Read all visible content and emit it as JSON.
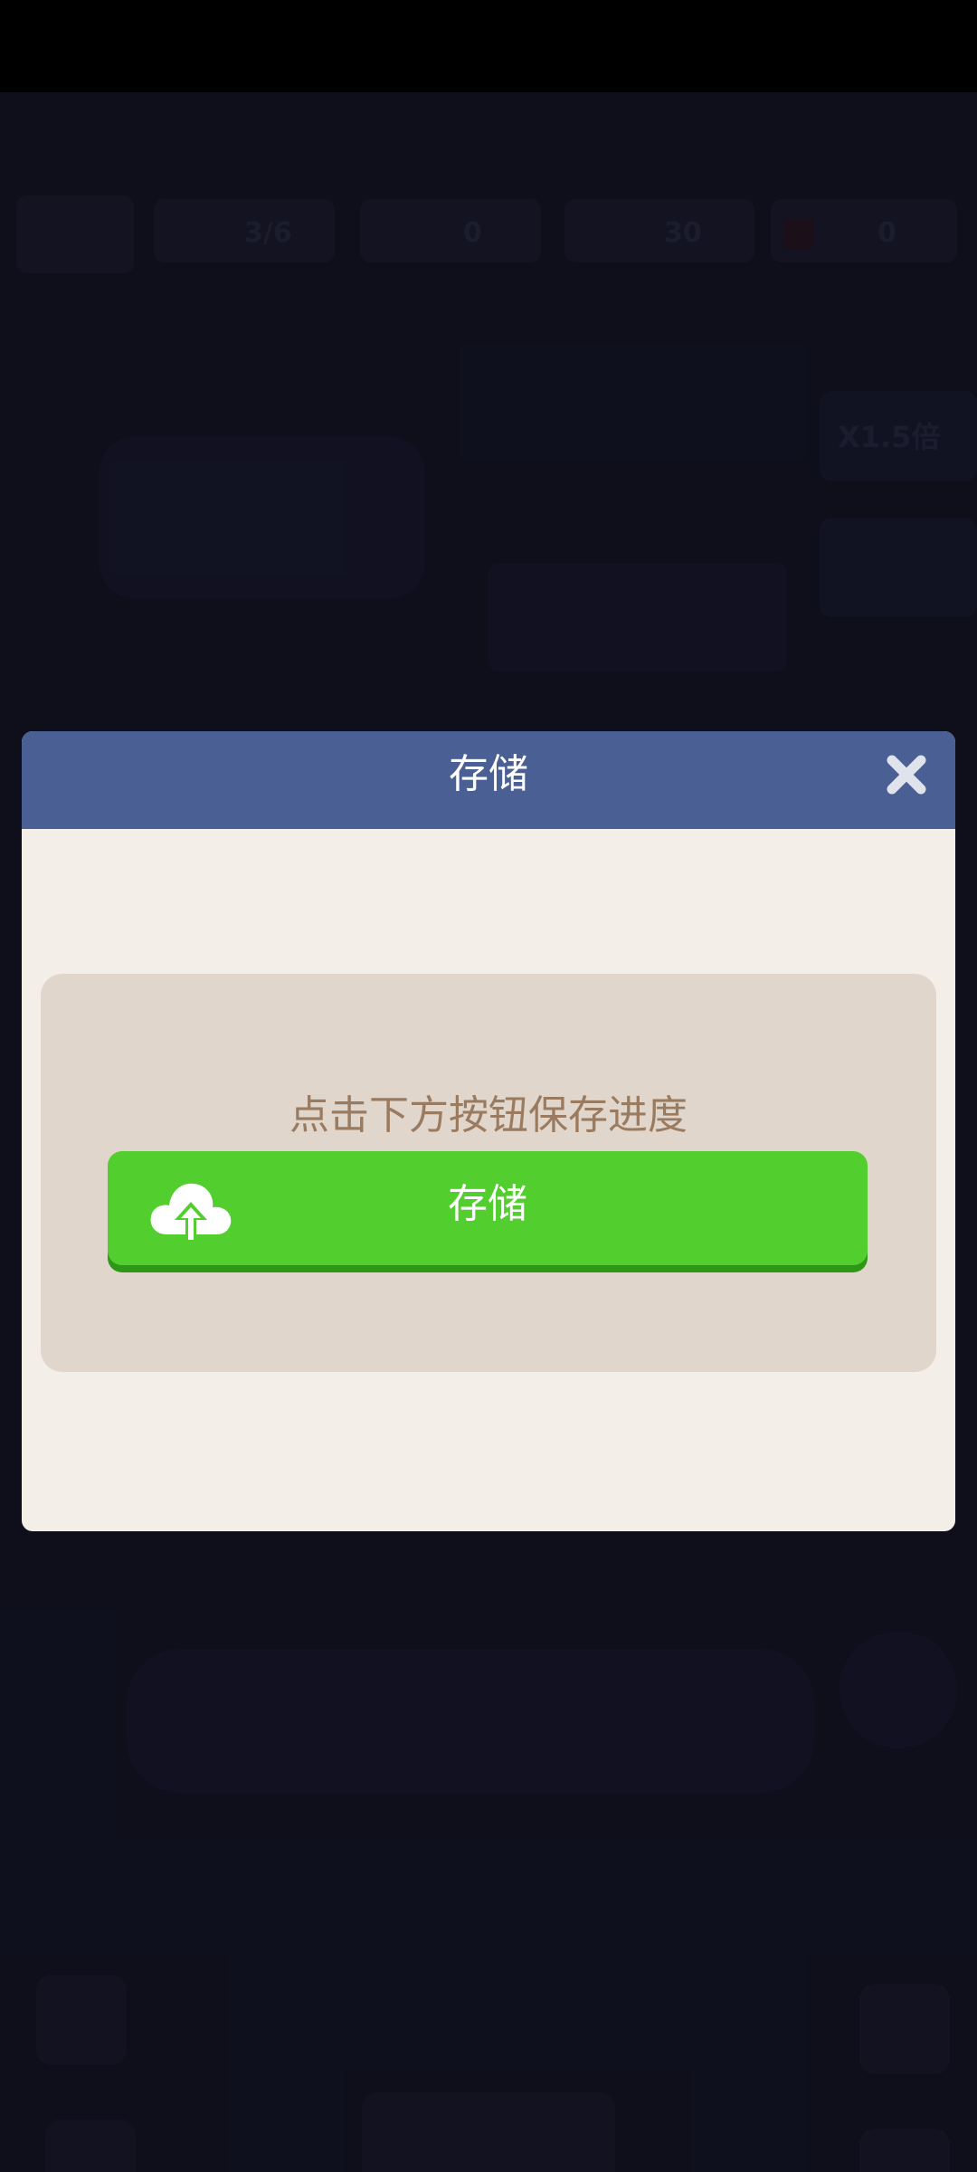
{
  "dialog": {
    "title": "存储",
    "prompt": "点击下方按钮保存进度",
    "save_button_label": "存储"
  },
  "background_hud": {
    "level": "3/6",
    "count_a": "0",
    "count_b": "30",
    "count_c": "0",
    "multiplier": "X1.5倍"
  },
  "colors": {
    "header": "#4a5f93",
    "dialog_body": "#f3efe8",
    "inner_panel": "#e0d6cb",
    "save_button": "#52cf2e",
    "prompt_text": "#9a7b60"
  },
  "icons": {
    "close": "close-icon",
    "save": "cloud-upload-icon"
  }
}
